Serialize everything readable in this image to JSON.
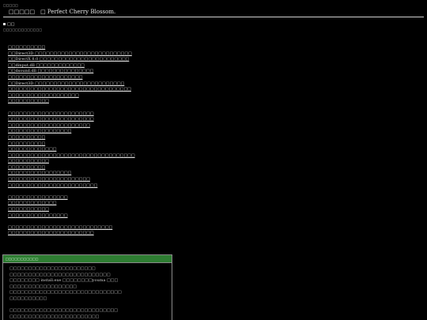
{
  "page": {
    "corner_mark": "□□□□□",
    "title": "□□□□□　□ Perfect Cherry Blossom.",
    "section_head": "□□",
    "section_sub": "□□□□□□□□□□□□□"
  },
  "links": [
    "□□□□□□□□□□",
    "□□Direct3D □□□□□□□□□□□□□□□□□□□□□□□□□□",
    "□□DirectX 8.0 □□□□□□□□□□□□□□□□□□□□□□□□",
    "□□dinput.dll □□□□□□□□□□□□□",
    "□□dsound.dll □□□□□□□□□□□□□□□",
    "□□□□□□□□□□□□□□□□□□□□",
    "□□Direct3D □□□□□□□□□□□□□□□□□□□□□□□□",
    "□□□□□□□□□□□□□□□□□□□□□□□□□□□□□□□□□",
    "□□□□□□□□□□□□□□□□□□□",
    "□□□□□□□□□□□",
    "",
    "□□□□□□□□□□□□□□□□□□□□□□□",
    "□□□□□□□□□□□□□□□□□□□□□□□",
    "□□□□□□□□□□□□□□□□□□□□□□",
    "□□□□□□□□□□□□□□□□□",
    "□□□□□□□□□□",
    "□□□□□□□□□□",
    "□□□□□□□□□□□□□",
    "□□□□□□□□□□□□□□□□□□□□□□□□□□□□□□□□□□",
    "□□□□□□□□□□□",
    "□□□□□□□□□□",
    "□□□□□□□□□□□□□□□□□",
    "□□□□□□□□□□□□□□□□□□□□□□",
    "□□□□□□□□□□□□□□□□□□□□□□□□",
    "",
    "□□□□□□□□□□□□□□□□",
    "□□□□□□□□□□□□□",
    "□□□□□□□□□□□",
    "□□□□□□□□□□□□□□□□",
    "",
    "□□□□□□□□□□□□□□□□□□□□□□□□□□□□",
    "□□□□□□□□□□□□□□□□□□□□□□□"
  ],
  "panel": {
    "header": "□□□□□□□□□□□",
    "lines": [
      "□□□□□□□□□□□□□□□□□□□□□□□",
      "□□□□□□□□□□□□□□□□□□□□□□□□□□□",
      "□□□□□□□□ install.exe □□□□□□□□youma □□□",
      "□□□□□□□□□□□□□□□□□□",
      "□□□□□□□□□□□□□□□□□□□□□□□□□□□□□□",
      "□□□□□□□□□□",
      "",
      "□□□□□□□□□□□□□□□□□□□□□□□□□□□□□",
      "□□□□□□□□□□□□□□□□□□□□□□□□"
    ]
  }
}
